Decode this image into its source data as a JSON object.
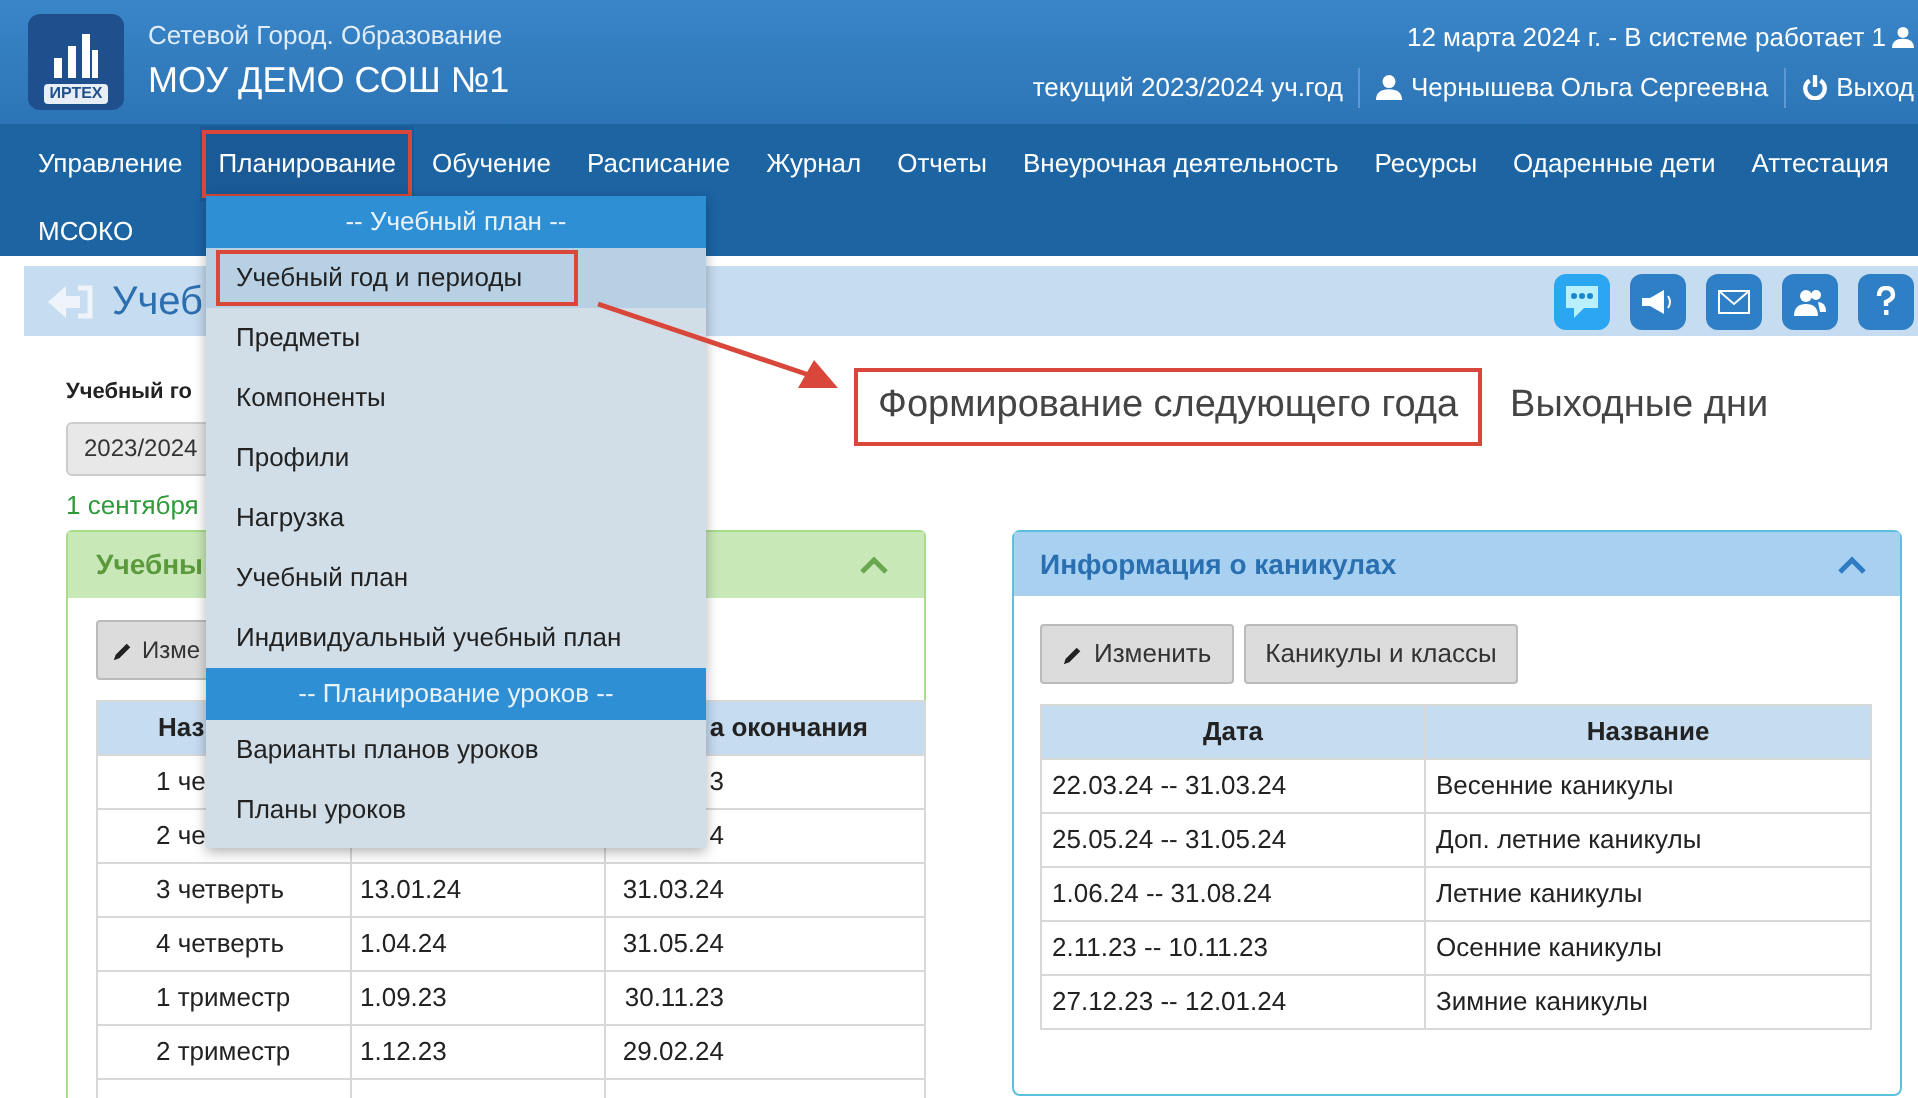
{
  "header": {
    "system": "Сетевой Город. Образование",
    "school": "МОУ ДЕМО СОШ №1",
    "logo_text": "ИРТЕХ",
    "status": "12 марта 2024 г. - В системе работает 1",
    "year": "текущий 2023/2024 уч.год",
    "user": "Чернышева Ольга Сергеевна",
    "logout": "Выход"
  },
  "nav": [
    {
      "label": "Управление",
      "selected": false,
      "annotated": false
    },
    {
      "label": "Планирование",
      "selected": true,
      "annotated": true
    },
    {
      "label": "Обучение",
      "selected": false,
      "annotated": false
    },
    {
      "label": "Расписание",
      "selected": false,
      "annotated": false
    },
    {
      "label": "Журнал",
      "selected": false,
      "annotated": false
    },
    {
      "label": "Отчеты",
      "selected": false,
      "annotated": false
    },
    {
      "label": "Внеурочная деятельность",
      "selected": false,
      "annotated": false
    },
    {
      "label": "Ресурсы",
      "selected": false,
      "annotated": false
    },
    {
      "label": "Одаренные дети",
      "selected": false,
      "annotated": false
    },
    {
      "label": "Аттестация",
      "selected": false,
      "annotated": false
    },
    {
      "label": "МСОКО",
      "selected": false,
      "annotated": false
    }
  ],
  "menu": [
    {
      "kind": "section",
      "label": "-- Учебный план --"
    },
    {
      "kind": "item",
      "label": "Учебный год и периоды",
      "selected": true,
      "annotated": true
    },
    {
      "kind": "item",
      "label": "Предметы",
      "selected": false,
      "annotated": false
    },
    {
      "kind": "item",
      "label": "Компоненты",
      "selected": false,
      "annotated": false
    },
    {
      "kind": "item",
      "label": "Профили",
      "selected": false,
      "annotated": false
    },
    {
      "kind": "item",
      "label": "Нагрузка",
      "selected": false,
      "annotated": false
    },
    {
      "kind": "item",
      "label": "Учебный план",
      "selected": false,
      "annotated": false
    },
    {
      "kind": "item",
      "label": "Индивидуальный учебный план",
      "selected": false,
      "annotated": false
    },
    {
      "kind": "section",
      "label": "-- Планирование уроков --"
    },
    {
      "kind": "item",
      "label": "Варианты планов уроков",
      "selected": false,
      "annotated": false
    },
    {
      "kind": "item",
      "label": "Планы уроков",
      "selected": false,
      "annotated": false
    }
  ],
  "page_title": "Учеб",
  "year_label": "Учебный го",
  "year_select": "2023/2024",
  "year_dates": "1 сентября",
  "links": [
    {
      "label": "Формирование следующего года",
      "annotated": true
    },
    {
      "label": "Выходные дни",
      "annotated": false
    }
  ],
  "periods_panel": {
    "title": "Учебны",
    "edit_button": "Изме",
    "columns": [
      "Наз",
      "",
      "а окончания"
    ],
    "rows": [
      [
        "1 че",
        "",
        "3"
      ],
      [
        "2 че",
        "",
        "4"
      ],
      [
        "3 четверть",
        "13.01.24",
        "31.03.24"
      ],
      [
        "4 четверть",
        "1.04.24",
        "31.05.24"
      ],
      [
        "1 триместр",
        "1.09.23",
        "30.11.23"
      ],
      [
        "2 триместр",
        "1.12.23",
        "29.02.24"
      ]
    ]
  },
  "holidays_panel": {
    "title": "Информация о каникулах",
    "buttons": [
      "Изменить",
      "Каникулы и классы"
    ],
    "columns": [
      "Дата",
      "Название"
    ],
    "rows": [
      [
        "22.03.24 -- 31.03.24",
        "Весенние каникулы"
      ],
      [
        "25.05.24 -- 31.05.24",
        "Доп. летние каникулы"
      ],
      [
        "1.06.24 -- 31.08.24",
        "Летние каникулы"
      ],
      [
        "2.11.23 -- 10.11.23",
        "Осенние каникулы"
      ],
      [
        "27.12.23 -- 12.01.24",
        "Зимние каникулы"
      ]
    ]
  }
}
